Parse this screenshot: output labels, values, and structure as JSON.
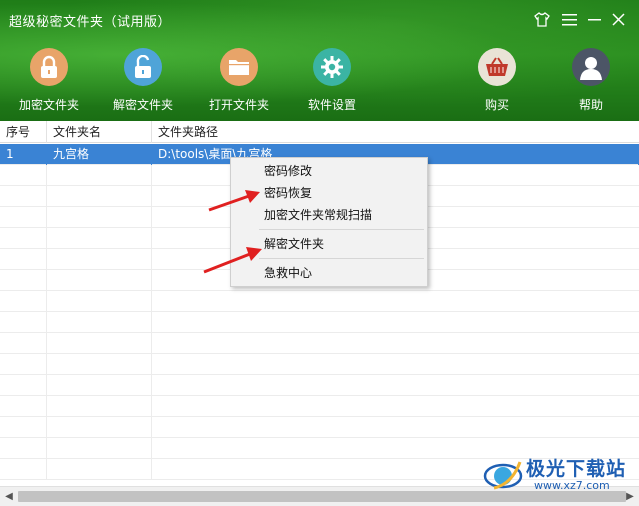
{
  "window": {
    "title": "超级秘密文件夹（试用版）"
  },
  "window_controls": [
    {
      "name": "skin-icon",
      "glyph": "👕"
    },
    {
      "name": "menu-icon",
      "glyph": "≡"
    },
    {
      "name": "minimize-icon",
      "glyph": "—"
    },
    {
      "name": "close-icon",
      "glyph": "✕"
    }
  ],
  "toolbar": {
    "encrypt": {
      "label": "加密文件夹",
      "icon": "lock-closed-icon",
      "color": "#e8a469"
    },
    "decrypt": {
      "label": "解密文件夹",
      "icon": "lock-open-icon",
      "color": "#4fa4d8"
    },
    "open": {
      "label": "打开文件夹",
      "icon": "folder-icon",
      "color": "#e8a469"
    },
    "settings": {
      "label": "软件设置",
      "icon": "gear-icon",
      "color": "#3bb4a4"
    },
    "buy": {
      "label": "购买",
      "icon": "basket-icon",
      "color": "#e9e3d6"
    },
    "help": {
      "label": "帮助",
      "icon": "user-avatar-icon",
      "color": "#4c5566"
    }
  },
  "table": {
    "headers": [
      "序号",
      "文件夹名",
      "文件夹路径"
    ],
    "rows": [
      {
        "no": "1",
        "name": "九宫格",
        "path": "D:\\tools\\桌面\\九宫格"
      }
    ],
    "selected_color": "#3a83d4"
  },
  "context_menu": {
    "items": [
      {
        "label": "密码修改"
      },
      {
        "label": "密码恢复"
      },
      {
        "label": "加密文件夹常规扫描"
      },
      {
        "label": "解密文件夹"
      },
      {
        "label": "急救中心"
      }
    ]
  },
  "watermark": {
    "text": "极光下载站",
    "url": "www.xz7.com"
  },
  "accent": {
    "header_green": "#2b8f20",
    "annotation_red": "#e02020"
  }
}
